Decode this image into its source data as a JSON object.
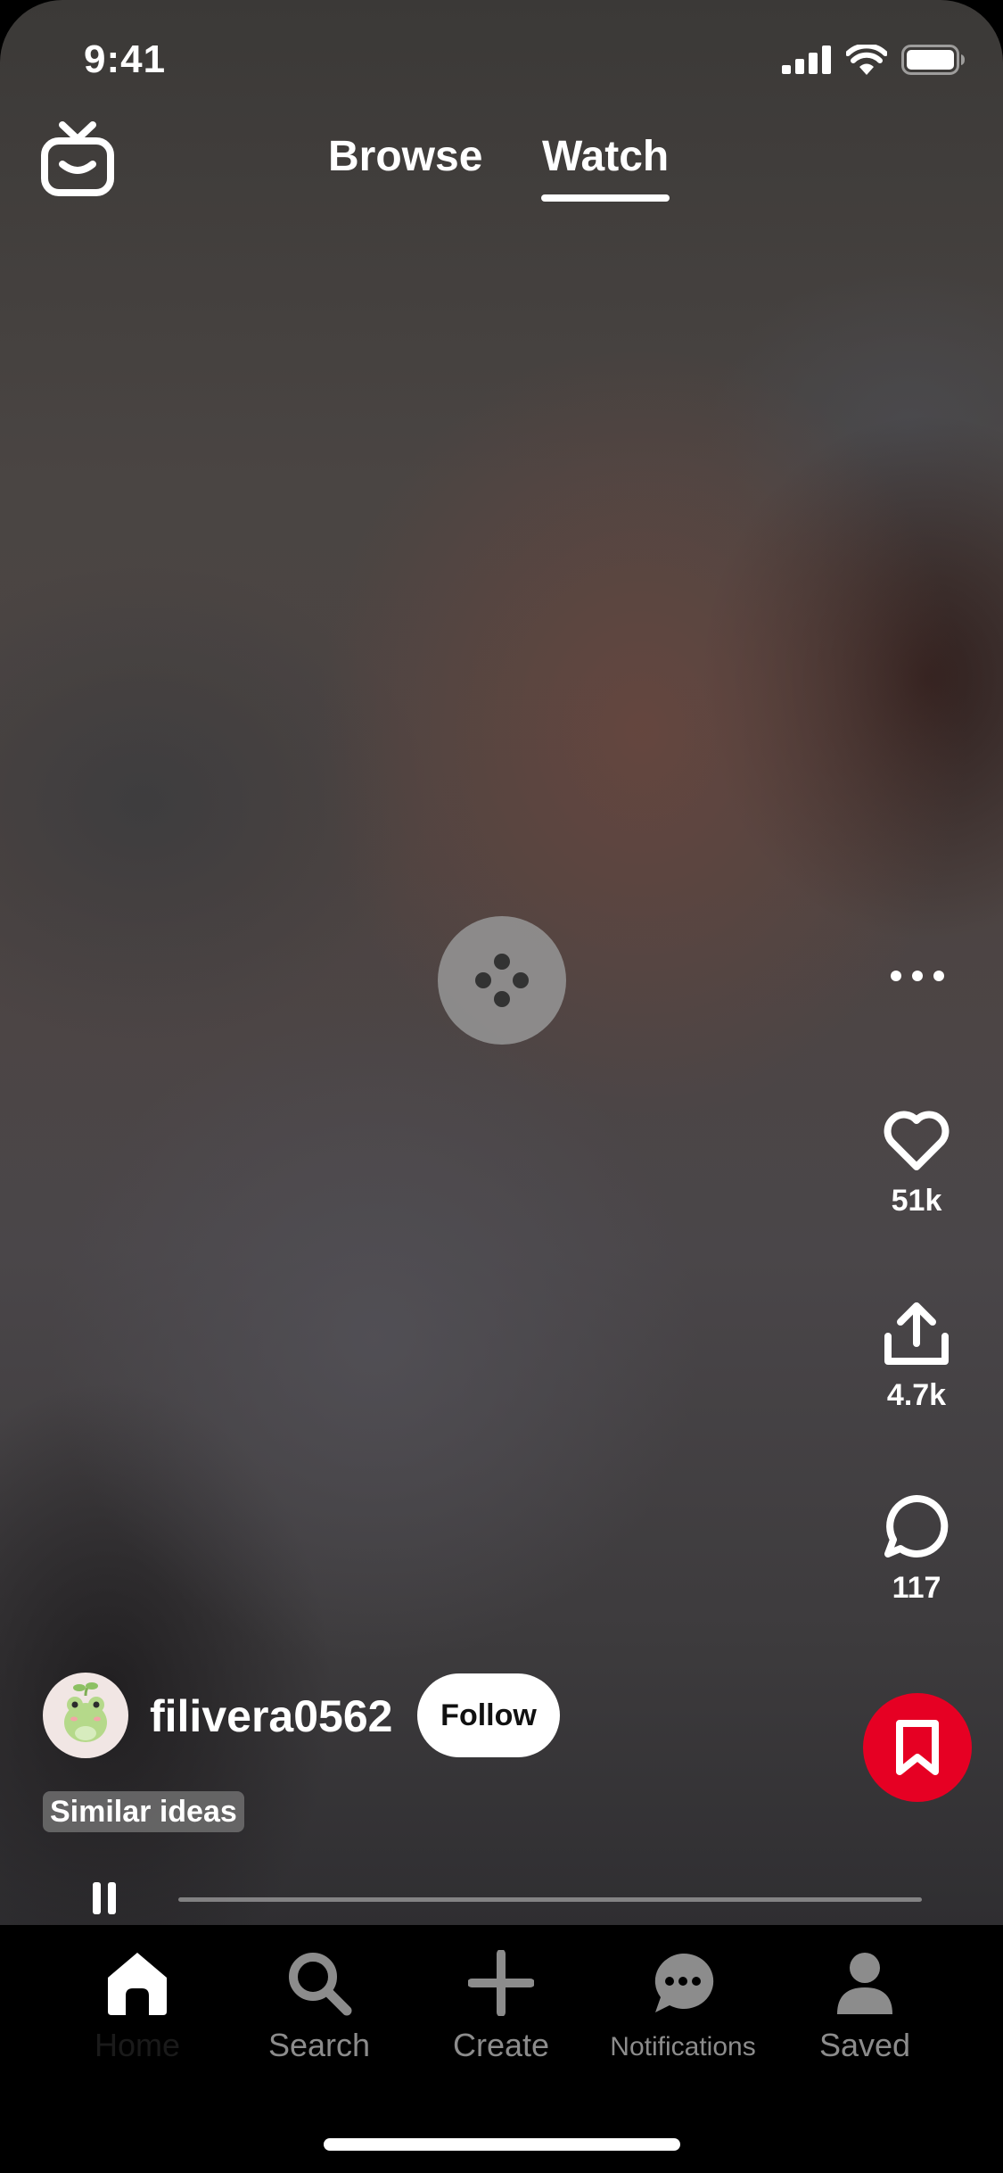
{
  "status_bar": {
    "time": "9:41"
  },
  "header": {
    "tabs": [
      {
        "label": "Browse",
        "active": false
      },
      {
        "label": "Watch",
        "active": true
      }
    ]
  },
  "actions": {
    "like": {
      "count": "51k"
    },
    "share": {
      "count": "4.7k"
    },
    "comments": {
      "count": "117"
    }
  },
  "creator": {
    "username": "filivera0562",
    "follow_label": "Follow",
    "similar_label": "Similar ideas"
  },
  "playback": {
    "progress": 0.0
  },
  "nav": {
    "items": [
      {
        "label": "Home",
        "icon": "home-icon",
        "active": true
      },
      {
        "label": "Search",
        "icon": "search-icon",
        "active": false
      },
      {
        "label": "Create",
        "icon": "plus-icon",
        "active": false
      },
      {
        "label": "Notifications",
        "icon": "chat-bubble-icon",
        "active": false
      },
      {
        "label": "Saved",
        "icon": "person-icon",
        "active": false
      }
    ]
  },
  "colors": {
    "brand_red": "#e60023",
    "inactive_gray": "#8c8c8c"
  }
}
